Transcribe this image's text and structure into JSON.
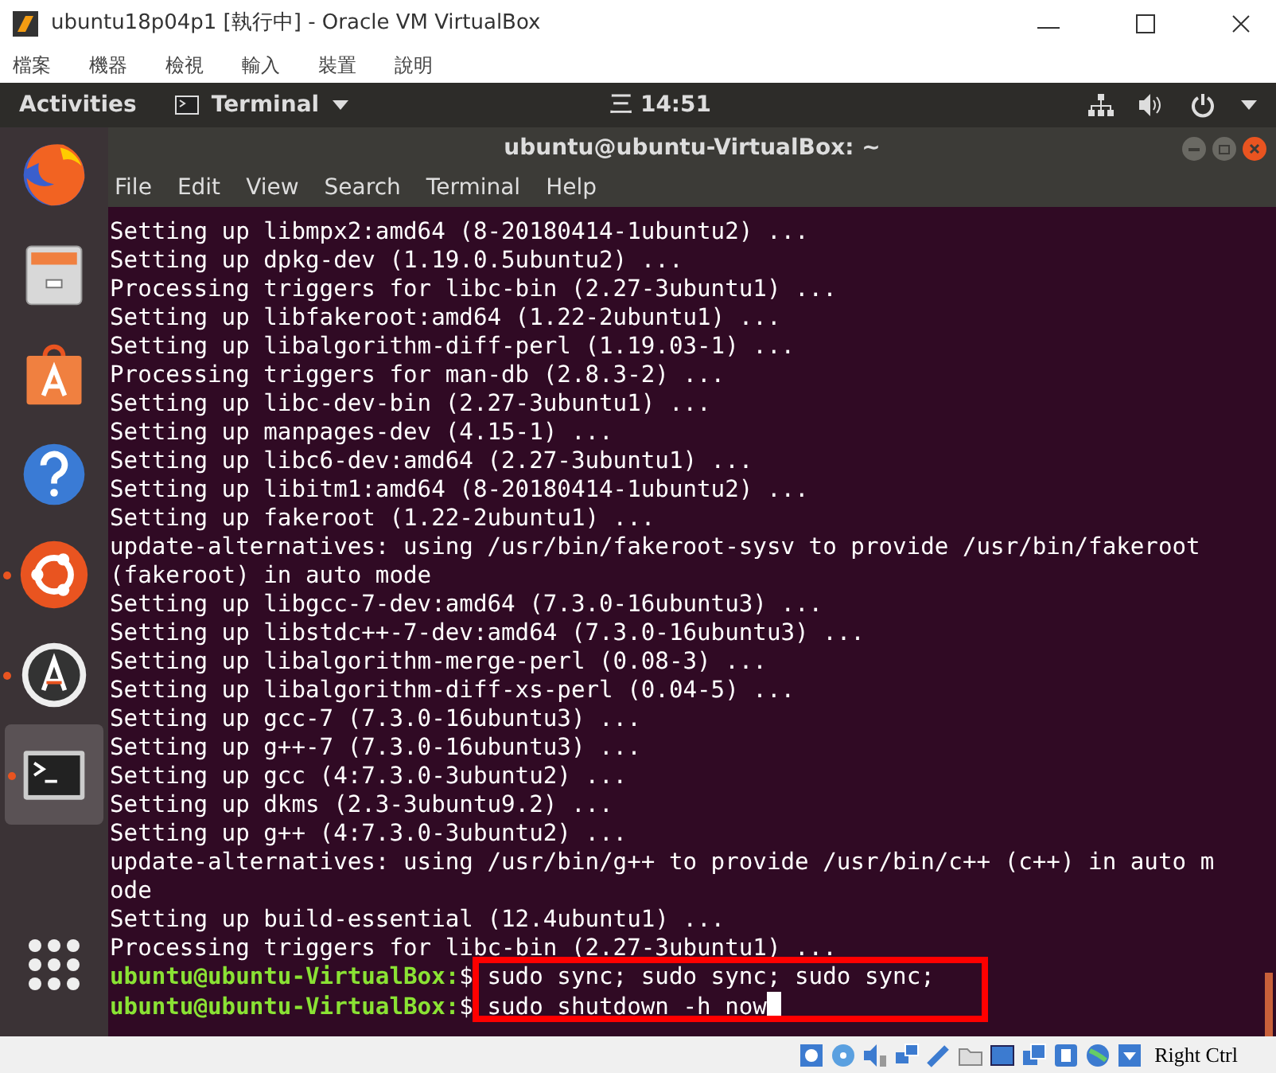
{
  "vm_window": {
    "title": "ubuntu18p04p1 [執行中] - Oracle VM VirtualBox",
    "menu": [
      "檔案",
      "機器",
      "檢視",
      "輸入",
      "裝置",
      "說明"
    ]
  },
  "top_bar": {
    "activities": "Activities",
    "app_menu": "Terminal",
    "clock": "三 14:51"
  },
  "dock": {
    "items": [
      {
        "kind": "firefox",
        "running": false,
        "selected": false
      },
      {
        "kind": "files",
        "running": false,
        "selected": false
      },
      {
        "kind": "software",
        "running": false,
        "selected": false
      },
      {
        "kind": "help",
        "running": false,
        "selected": false
      },
      {
        "kind": "ubuntu",
        "running": true,
        "selected": false
      },
      {
        "kind": "updater",
        "running": true,
        "selected": false
      },
      {
        "kind": "terminal",
        "running": true,
        "selected": true
      }
    ]
  },
  "terminal": {
    "title": "ubuntu@ubuntu-VirtualBox: ~",
    "menu": [
      "File",
      "Edit",
      "View",
      "Search",
      "Terminal",
      "Help"
    ],
    "lines": [
      {
        "kind": "output",
        "text": "Setting up libmpx2:amd64 (8-20180414-1ubuntu2) ..."
      },
      {
        "kind": "output",
        "text": "Setting up dpkg-dev (1.19.0.5ubuntu2) ..."
      },
      {
        "kind": "output",
        "text": "Processing triggers for libc-bin (2.27-3ubuntu1) ..."
      },
      {
        "kind": "output",
        "text": "Setting up libfakeroot:amd64 (1.22-2ubuntu1) ..."
      },
      {
        "kind": "output",
        "text": "Setting up libalgorithm-diff-perl (1.19.03-1) ..."
      },
      {
        "kind": "output",
        "text": "Processing triggers for man-db (2.8.3-2) ..."
      },
      {
        "kind": "output",
        "text": "Setting up libc-dev-bin (2.27-3ubuntu1) ..."
      },
      {
        "kind": "output",
        "text": "Setting up manpages-dev (4.15-1) ..."
      },
      {
        "kind": "output",
        "text": "Setting up libc6-dev:amd64 (2.27-3ubuntu1) ..."
      },
      {
        "kind": "output",
        "text": "Setting up libitm1:amd64 (8-20180414-1ubuntu2) ..."
      },
      {
        "kind": "output",
        "text": "Setting up fakeroot (1.22-2ubuntu1) ..."
      },
      {
        "kind": "output",
        "text": "update-alternatives: using /usr/bin/fakeroot-sysv to provide /usr/bin/fakeroot"
      },
      {
        "kind": "output",
        "text": "(fakeroot) in auto mode"
      },
      {
        "kind": "output",
        "text": "Setting up libgcc-7-dev:amd64 (7.3.0-16ubuntu3) ..."
      },
      {
        "kind": "output",
        "text": "Setting up libstdc++-7-dev:amd64 (7.3.0-16ubuntu3) ..."
      },
      {
        "kind": "output",
        "text": "Setting up libalgorithm-merge-perl (0.08-3) ..."
      },
      {
        "kind": "output",
        "text": "Setting up libalgorithm-diff-xs-perl (0.04-5) ..."
      },
      {
        "kind": "output",
        "text": "Setting up gcc-7 (7.3.0-16ubuntu3) ..."
      },
      {
        "kind": "output",
        "text": "Setting up g++-7 (7.3.0-16ubuntu3) ..."
      },
      {
        "kind": "output",
        "text": "Setting up gcc (4:7.3.0-3ubuntu2) ..."
      },
      {
        "kind": "output",
        "text": "Setting up dkms (2.3-3ubuntu9.2) ..."
      },
      {
        "kind": "output",
        "text": "Setting up g++ (4:7.3.0-3ubuntu2) ..."
      },
      {
        "kind": "output",
        "text": "update-alternatives: using /usr/bin/g++ to provide /usr/bin/c++ (c++) in auto m"
      },
      {
        "kind": "output",
        "text": "ode"
      },
      {
        "kind": "output",
        "text": "Setting up build-essential (12.4ubuntu1) ..."
      },
      {
        "kind": "output",
        "text": "Processing triggers for libc-bin (2.27-3ubuntu1) ..."
      },
      {
        "kind": "prompt",
        "prompt": "ubuntu@ubuntu-VirtualBox:",
        "command": "$ sudo sync; sudo sync; sudo sync;",
        "highlighted": true,
        "cursor": false
      },
      {
        "kind": "prompt",
        "prompt": "ubuntu@ubuntu-VirtualBox:",
        "command": "$ sudo shutdown -h now",
        "highlighted": true,
        "cursor": true
      }
    ]
  },
  "status_bar": {
    "host_key": "Right Ctrl"
  }
}
